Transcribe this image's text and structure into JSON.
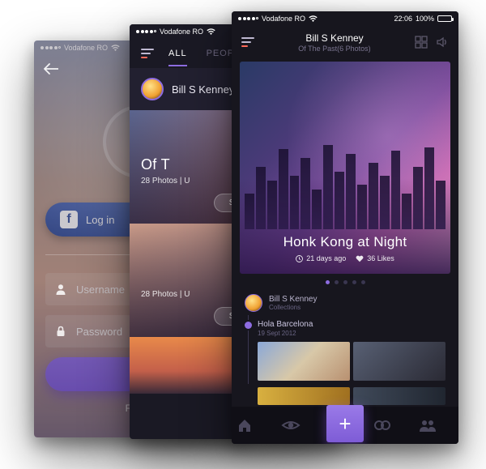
{
  "status": {
    "carrier": "Vodafone RO",
    "time": "22:06",
    "battery_pct": "100%"
  },
  "login": {
    "fb_label": "Log in",
    "username_placeholder": "Username",
    "password_placeholder": "Password",
    "forgot_label": "Forgot"
  },
  "feed": {
    "tabs": {
      "all": "ALL",
      "people": "PEOPLE"
    },
    "user_name": "Bill S Kenney",
    "card1": {
      "title": "Of T",
      "meta": "28 Photos | U",
      "btn": "Sul"
    },
    "card2": {
      "meta": "28 Photos | U",
      "btn": "Sul"
    }
  },
  "gallery": {
    "header": {
      "title": "Bill S Kenney",
      "subtitle": "Of The Past(6 Photos)"
    },
    "hero": {
      "title": "Honk Kong at Night",
      "time_ago": "21 days ago",
      "likes": "36 Likes"
    },
    "collections": {
      "owner": "Bill S Kenney",
      "label": "Collections"
    },
    "timeline": {
      "item1_title": "Hola Barcelona",
      "item1_date": "19 Sept 2012"
    },
    "tabbar_plus": "+"
  }
}
